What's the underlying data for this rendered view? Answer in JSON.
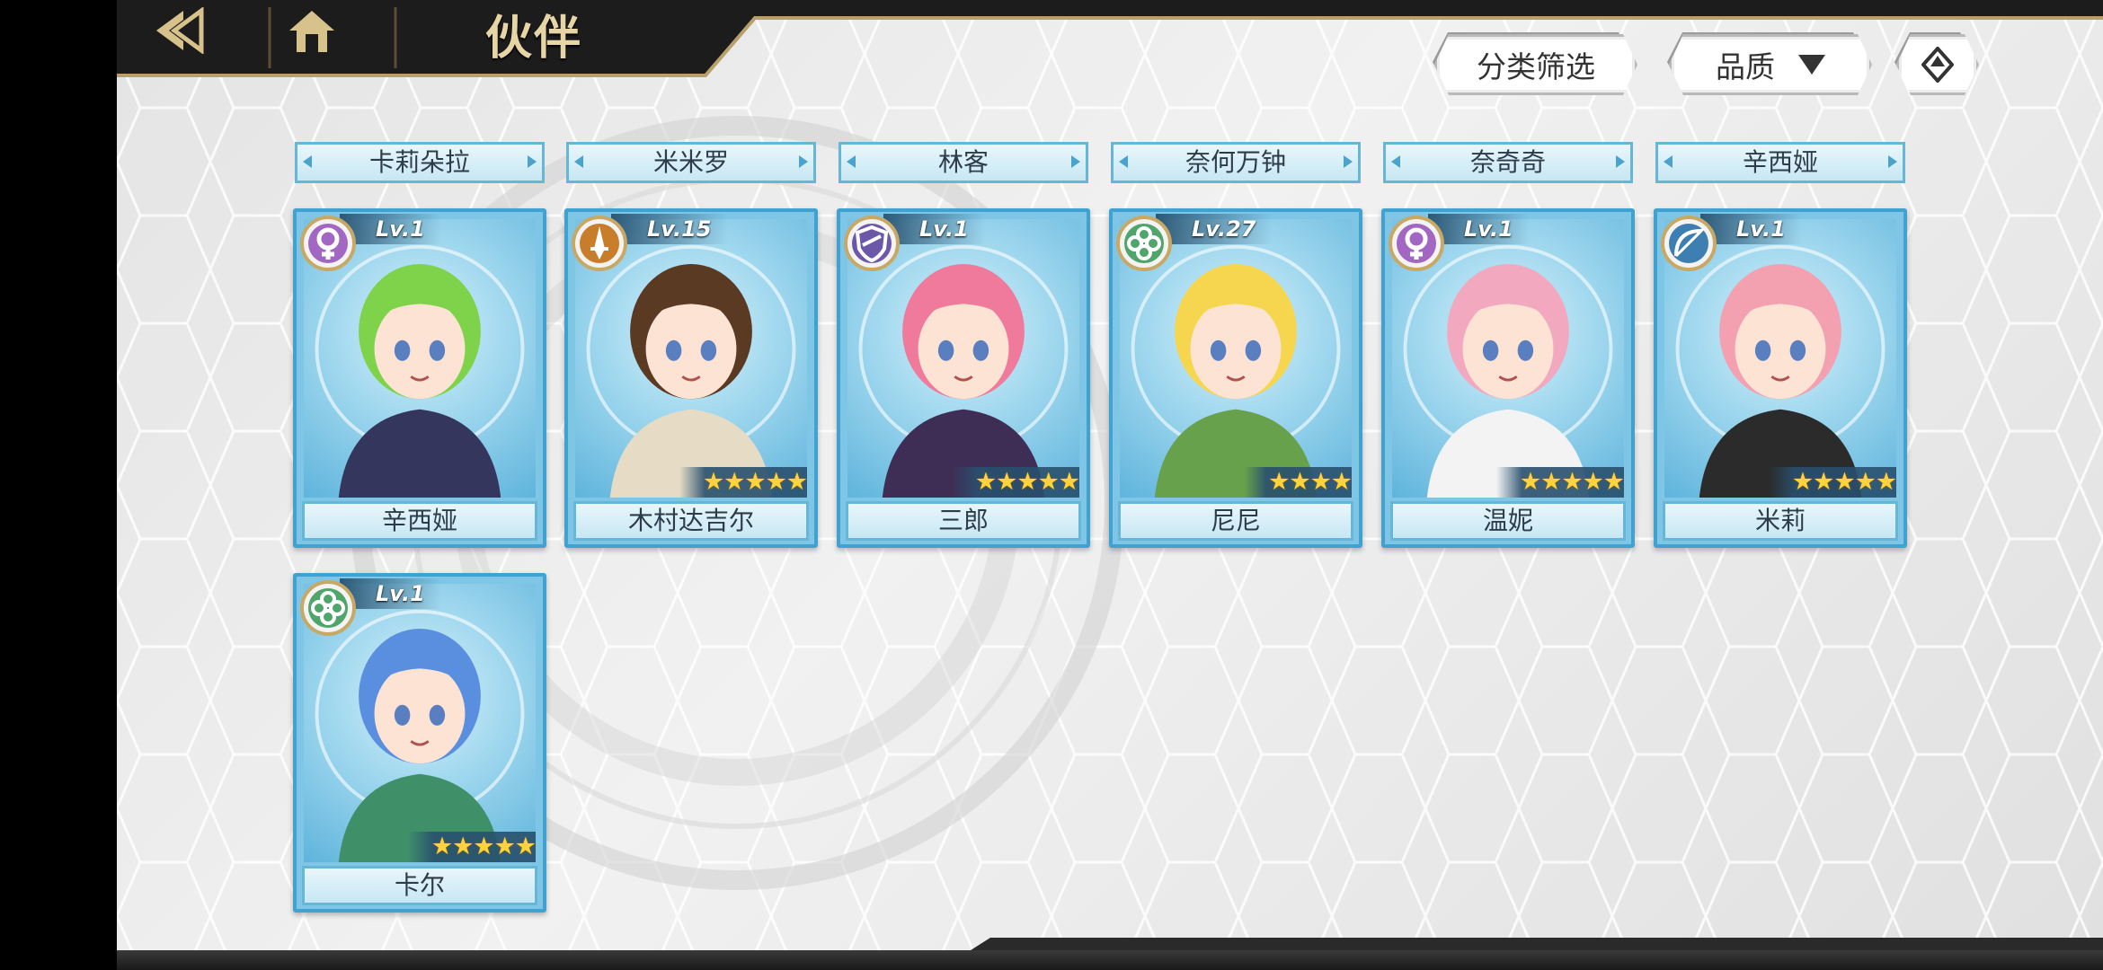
{
  "header": {
    "title": "伙伴",
    "back_icon": "back-arrow-icon",
    "home_icon": "home-icon"
  },
  "toolbar": {
    "filter_label": "分类筛选",
    "sort_label": "品质",
    "sort_icon": "triangle-down-icon",
    "order_icon": "diamond-arrow-icon"
  },
  "tabs": [
    "卡莉朵拉",
    "米米罗",
    "林客",
    "奈何万钟",
    "奈奇奇",
    "辛西娅"
  ],
  "partners": [
    {
      "name": "辛西娅",
      "level": "Lv.1",
      "class_icon": "female-symbol-icon",
      "class_color": "#a167c2",
      "stars": 0,
      "hair": "#7fd34b",
      "outfit": "#34365e"
    },
    {
      "name": "木村达吉尔",
      "level": "Lv.15",
      "class_icon": "sword-icon",
      "class_color": "#c77d2a",
      "stars": 5,
      "hair": "#5b3a24",
      "outfit": "#e6dcc6"
    },
    {
      "name": "三郎",
      "level": "Lv.1",
      "class_icon": "shield-icon",
      "class_color": "#6b58a8",
      "stars": 5,
      "hair": "#f07a9b",
      "outfit": "#3e2e55"
    },
    {
      "name": "尼尼",
      "level": "Lv.27",
      "class_icon": "clover-icon",
      "class_color": "#4fa56a",
      "stars": 4,
      "hair": "#f5d64e",
      "outfit": "#67a14b"
    },
    {
      "name": "温妮",
      "level": "Lv.1",
      "class_icon": "female-symbol-icon",
      "class_color": "#a167c2",
      "stars": 5,
      "hair": "#f2a9c0",
      "outfit": "#f3f3f3"
    },
    {
      "name": "米莉",
      "level": "Lv.1",
      "class_icon": "bow-icon",
      "class_color": "#3d7fb2",
      "stars": 5,
      "hair": "#f3a1b0",
      "outfit": "#2b2b2b"
    },
    {
      "name": "卡尔",
      "level": "Lv.1",
      "class_icon": "clover-icon",
      "class_color": "#4fa56a",
      "stars": 5,
      "hair": "#5a8fe0",
      "outfit": "#3f8f69"
    }
  ],
  "scroll": {
    "position": 0,
    "visible_fraction": 0.8
  }
}
